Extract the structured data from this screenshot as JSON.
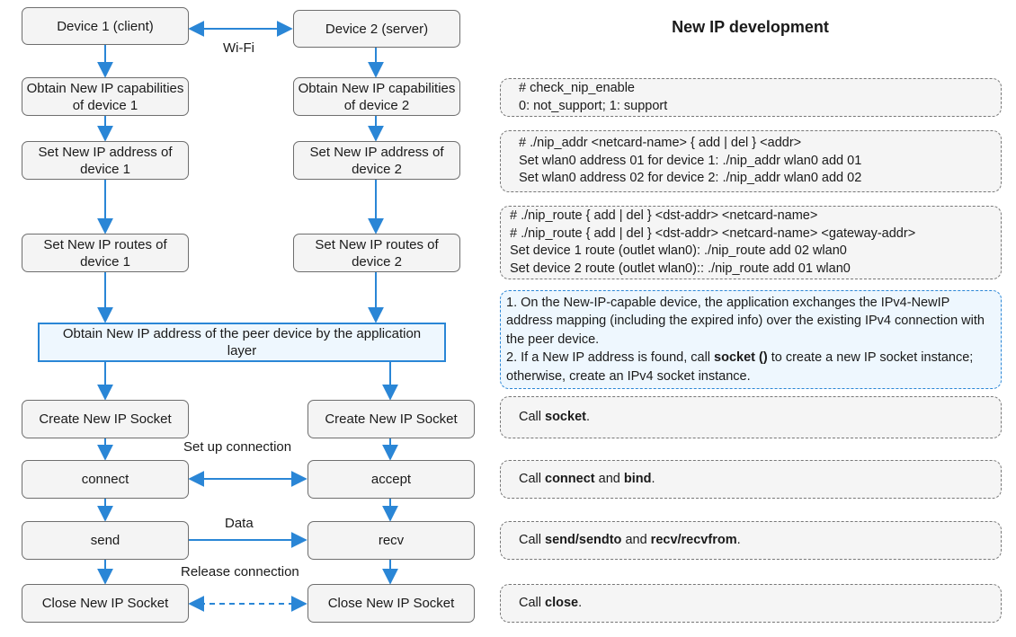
{
  "title": "New IP development",
  "flow": {
    "device1": "Device 1 (client)",
    "device2": "Device 2 (server)",
    "wifi_label": "Wi-Fi",
    "cap1": "Obtain New IP capabilities of device 1",
    "cap2": "Obtain New IP capabilities of device 2",
    "addr1": "Set New IP address of device 1",
    "addr2": "Set New IP address of device 2",
    "route1": "Set New IP routes of device 1",
    "route2": "Set New IP routes of device 2",
    "peer": "Obtain New IP address of the peer device by the application layer",
    "create1": "Create New IP Socket",
    "create2": "Create New IP Socket",
    "setup_label": "Set up connection",
    "connect": "connect",
    "accept": "accept",
    "data_label": "Data",
    "send": "send",
    "recv": "recv",
    "release_label": "Release connection",
    "close1": "Close New IP Socket",
    "close2": "Close New IP Socket"
  },
  "notes": {
    "capability": [
      "# check_nip_enable",
      "0: not_support; 1: support"
    ],
    "address": [
      "# ./nip_addr <netcard-name> { add | del } <addr>",
      "Set wlan0 address 01 for device 1: ./nip_addr wlan0 add 01",
      "Set wlan0 address 02 for device 2: ./nip_addr wlan0 add 02"
    ],
    "route": [
      "# ./nip_route { add | del } <dst-addr> <netcard-name>",
      "# ./nip_route { add | del } <dst-addr> <netcard-name> <gateway-addr>",
      "Set device 1 route (outlet wlan0): ./nip_route add 02 wlan0",
      "Set device 2 route (outlet wlan0):: ./nip_route add 01 wlan0"
    ],
    "peer": {
      "line1": "1. On the New-IP-capable device, the application exchanges the IPv4-NewIP address mapping (including the expired info) over the existing IPv4 connection with the peer device.",
      "line2_pre": "2. If a New IP address is found, call ",
      "line2_bold": "socket ()",
      "line2_post": " to create a new IP socket instance; otherwise, create an IPv4 socket instance."
    },
    "socket": {
      "pre": "Call ",
      "b1": "socket",
      "post": "."
    },
    "connect": {
      "pre": "Call ",
      "b1": "connect",
      "mid": " and ",
      "b2": "bind",
      "post": "."
    },
    "send": {
      "pre": "Call ",
      "b1": "send/sendto",
      "mid": " and ",
      "b2": "recv/recvfrom",
      "post": "."
    },
    "close": {
      "pre": "Call ",
      "b1": "close",
      "post": "."
    }
  },
  "colors": {
    "arrow": "#2a86d6",
    "box_fill": "#f4f4f4",
    "box_border": "#6e6e6e",
    "highlight_fill": "#eef7fe"
  }
}
